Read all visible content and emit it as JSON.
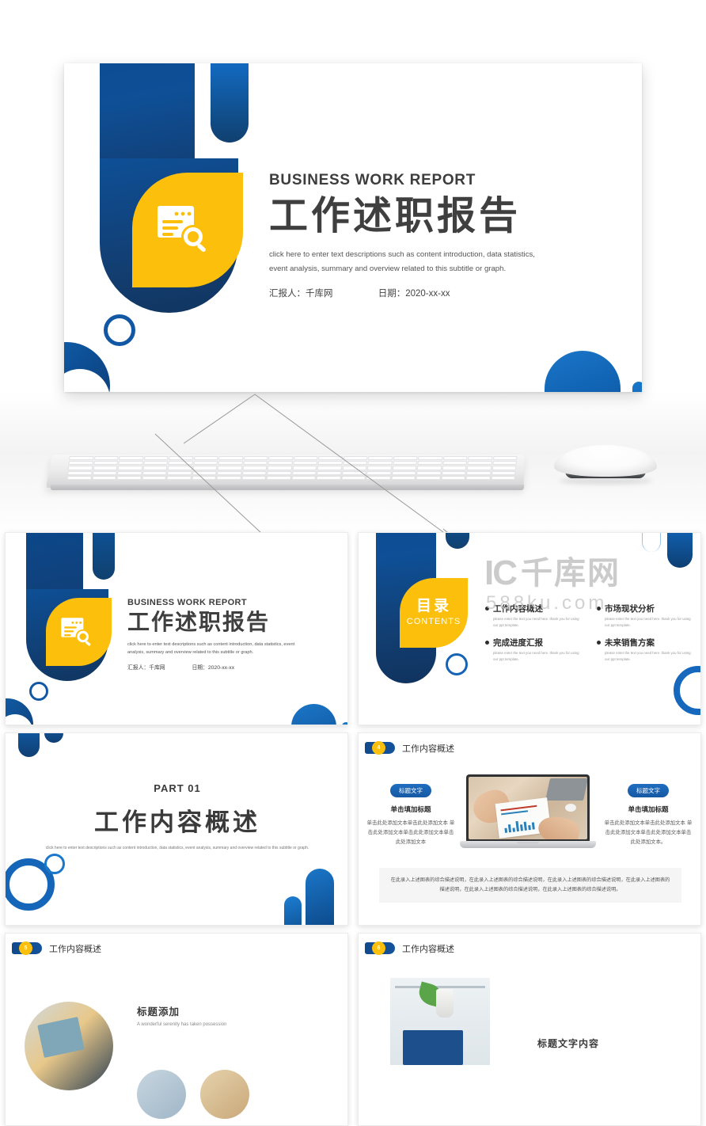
{
  "brand": {
    "accent_blue": "#0e4f96",
    "accent_blue_light": "#1b76c8",
    "accent_yellow": "#fcbf0c",
    "text_dark": "#3f3f3f"
  },
  "hero": {
    "kicker": "BUSINESS WORK REPORT",
    "title": "工作述职报告",
    "description": "click here to enter text descriptions such as content introduction, data statistics, event analysis, summary and overview related to this subtitle or graph.",
    "reporter_label": "汇报人：千库网",
    "date_label": "日期：2020-xx-xx",
    "icon": "document-search-icon"
  },
  "mockup": {
    "keyboard": "keyboard-mockup",
    "mouse": "mouse-mockup"
  },
  "watermark": {
    "mark": "IC",
    "zh": "千库网",
    "sub": "588ku.com"
  },
  "thumbnails": [
    {
      "id": "slide-1-cover",
      "kicker": "BUSINESS WORK REPORT",
      "title": "工作述职报告",
      "description": "click here to enter text descriptions such as content introduction, data statistics, event analysis, summary and overview related to this subtitle or graph.",
      "reporter_label": "汇报人：千库网",
      "date_label": "日期：2020-xx-xx"
    },
    {
      "id": "slide-2-contents",
      "leaf_zh": "目录",
      "leaf_en": "CONTENTS",
      "items": [
        {
          "title": "工作内容概述",
          "sub": "please enter the text you need here. thank you for using our ppt template."
        },
        {
          "title": "市场现状分析",
          "sub": "please enter the text you need here. thank you for using our ppt template."
        },
        {
          "title": "完成进度汇报",
          "sub": "please enter the text you need here. thank you for using our ppt template."
        },
        {
          "title": "未来销售方案",
          "sub": "please enter the text you need here. thank you for using our ppt template."
        }
      ]
    },
    {
      "id": "slide-3-part01",
      "part": "PART 01",
      "title": "工作内容概述",
      "description": "click here to enter text descriptions such as content introduction, data statistics, event analysis, summary and overview related to this subtitle or graph."
    },
    {
      "id": "slide-4-overview",
      "number": "4",
      "header": "工作内容概述",
      "left": {
        "pill": "标题文字",
        "heading": "单击填加标题",
        "body": "单击此处添加文本单击此处添加文本 单击此处添加文本单击此处添加文本单击此处添加文本"
      },
      "right": {
        "pill": "标题文字",
        "heading": "单击填加标题",
        "body": "单击此处添加文本单击此处添加文本 单击此处添加文本单击此处添加文本单击此处添加文本。"
      },
      "note": "在此录入上述图表的综合描述说明，在此录入上述图表的综合描述说明，在此录入上述图表的综合描述说明，在此录入上述图表的描述说明，在此录入上述图表的综合描述说明，在此录入上述图表的综合描述说明。"
    },
    {
      "id": "slide-5-overview",
      "number": "5",
      "header": "工作内容概述",
      "heading": "标题添加",
      "sub": "A wonderful serenity has taken possession"
    },
    {
      "id": "slide-6-overview",
      "number": "6",
      "header": "工作内容概述",
      "heading": "标题文字内容"
    }
  ]
}
